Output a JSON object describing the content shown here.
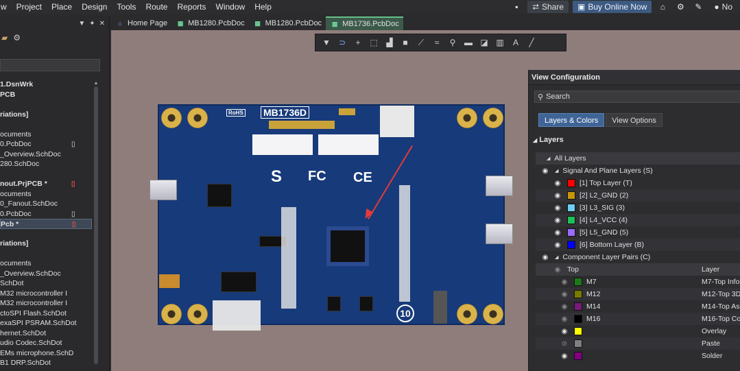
{
  "menu": [
    "w",
    "Project",
    "Place",
    "Design",
    "Tools",
    "Route",
    "Reports",
    "Window",
    "Help"
  ],
  "topbar": {
    "share_label": "Share",
    "buy_label": "Buy Online Now",
    "account_label": "No"
  },
  "left_panel": {
    "header_icons": [
      "▼",
      "✦",
      "✕"
    ],
    "tree": [
      {
        "text": "1.DsnWrk",
        "bold": true
      },
      {
        "text": "PCB",
        "bold": true
      },
      {
        "text": ""
      },
      {
        "text": "riations]",
        "bold": true
      },
      {
        "text": ""
      },
      {
        "text": "ocuments"
      },
      {
        "text": "0.PcbDoc",
        "badge": "white"
      },
      {
        "text": "_Overview.SchDoc"
      },
      {
        "text": "280.SchDoc"
      },
      {
        "text": ""
      },
      {
        "text": "nout.PrjPCB *",
        "bold": true,
        "badge": "red"
      },
      {
        "text": "ocuments"
      },
      {
        "text": "0_Fanout.SchDoc"
      },
      {
        "text": "0.PcbDoc",
        "badge": "white"
      },
      {
        "text": "Pcb *",
        "bold": true,
        "badge": "red",
        "selected": true
      },
      {
        "text": ""
      },
      {
        "text": "riations]",
        "bold": true
      },
      {
        "text": ""
      },
      {
        "text": "ocuments"
      },
      {
        "text": "_Overview.SchDoc"
      },
      {
        "text": "SchDot"
      },
      {
        "text": "M32 microcontroller I"
      },
      {
        "text": "M32 microcontroller I"
      },
      {
        "text": "ctoSPI Flash.SchDot"
      },
      {
        "text": "exaSPI PSRAM.SchDot"
      },
      {
        "text": "hernet.SchDot"
      },
      {
        "text": "udio Codec.SchDot"
      },
      {
        "text": "EMs microphone.SchD"
      },
      {
        "text": "B1 DRP.SchDot"
      }
    ]
  },
  "tabs": [
    {
      "label": "Home Page",
      "icon": "home-icon",
      "active": false
    },
    {
      "label": "MB1280.PcbDoc",
      "icon": "pcb-doc-icon",
      "active": false
    },
    {
      "label": "MB1280.PcbDoc",
      "icon": "pcb-doc-icon",
      "active": false
    },
    {
      "label": "MB1736.PcbDoc",
      "icon": "pcb-doc-icon",
      "active": true
    }
  ],
  "board": {
    "title": "MB1736D",
    "rohs": "RoHS",
    "s_mark": "S",
    "fc_mark": "FC",
    "ce_mark": "CE"
  },
  "view_config": {
    "title": "View Configuration",
    "search_placeholder": "Search",
    "tabs": [
      "Layers & Colors",
      "View Options"
    ],
    "layers_header": "Layers",
    "all_layers": "All Layers",
    "signal_group": "Signal And Plane Layers (S)",
    "signal_layers": [
      {
        "name": "[1] Top Layer (T)",
        "color": "#ff0000"
      },
      {
        "name": "[2] L2_GND (2)",
        "color": "#c8960a"
      },
      {
        "name": "[3] L3_SIG (3)",
        "color": "#6ccff6"
      },
      {
        "name": "[4] L4_VCC (4)",
        "color": "#1fbf5a"
      },
      {
        "name": "[5] L5_GND (5)",
        "color": "#9b6bff"
      },
      {
        "name": "[6] Bottom Layer (B)",
        "color": "#0000ff"
      }
    ],
    "component_group": "Component Layer Pairs (C)",
    "col_top": "Top",
    "col_layer": "Layer",
    "component_pairs": [
      {
        "name": "M7",
        "color": "#1a7a1a",
        "layer": "M7-Top Info"
      },
      {
        "name": "M12",
        "color": "#7a7a00",
        "layer": "M12-Top 3D"
      },
      {
        "name": "M14",
        "color": "#7a1a7a",
        "layer": "M14-Top As"
      },
      {
        "name": "M16",
        "color": "#000000",
        "layer": "M16-Top Co"
      }
    ],
    "other_layers": [
      {
        "name": "Overlay",
        "color": "#ffff00",
        "eye": "on"
      },
      {
        "name": "Paste",
        "color": "#808080",
        "eye": "off"
      },
      {
        "name": "Solder",
        "color": "#800080",
        "eye": "on"
      }
    ]
  }
}
